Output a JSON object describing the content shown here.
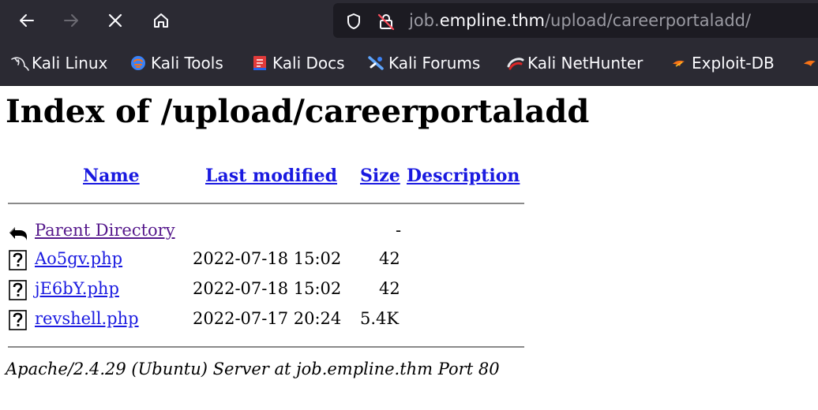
{
  "browser": {
    "url": {
      "prefix": "job.",
      "domain": "empline.thm",
      "path": "/upload/careerportaladd/"
    },
    "bookmarks": [
      {
        "label": "Kali Linux",
        "icon": "kali-dragon-icon"
      },
      {
        "label": "Kali Tools",
        "icon": "kali-tools-icon"
      },
      {
        "label": "Kali Docs",
        "icon": "kali-docs-icon"
      },
      {
        "label": "Kali Forums",
        "icon": "kali-forums-icon"
      },
      {
        "label": "Kali NetHunter",
        "icon": "kali-nethunter-icon"
      },
      {
        "label": "Exploit-DB",
        "icon": "exploit-db-icon"
      }
    ]
  },
  "page": {
    "title": "Index of /upload/careerportaladd",
    "columns": {
      "name": "Name",
      "last_modified": "Last modified",
      "size": "Size",
      "description": "Description"
    },
    "parent": {
      "name": "Parent Directory",
      "modified": "",
      "size": "-"
    },
    "files": [
      {
        "name": "Ao5gv.php",
        "modified": "2022-07-18 15:02",
        "size": "42"
      },
      {
        "name": "jE6bY.php",
        "modified": "2022-07-18 15:02",
        "size": "42"
      },
      {
        "name": "revshell.php",
        "modified": "2022-07-17 20:24",
        "size": "5.4K"
      }
    ],
    "footer": "Apache/2.4.29 (Ubuntu) Server at job.empline.thm Port 80"
  },
  "colors": {
    "chrome_bg": "#2b2a33",
    "urlbar_bg": "#1c1b22",
    "link": "#1a1ae0",
    "visited_link": "#55188b"
  }
}
